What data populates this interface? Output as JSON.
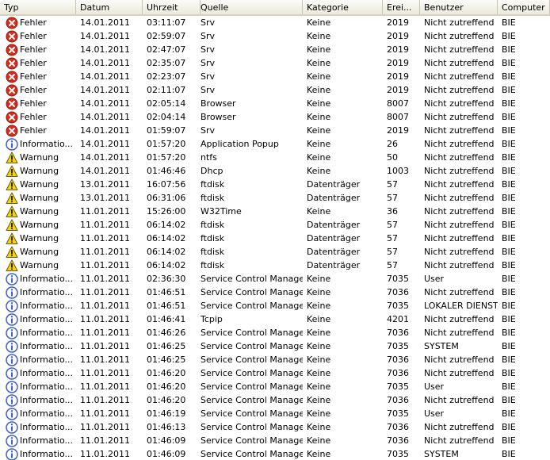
{
  "columns": [
    "Typ",
    "Datum",
    "Uhrzeit",
    "Quelle",
    "Kategorie",
    "Erei...",
    "Benutzer",
    "Computer"
  ],
  "icon_colors": {
    "error": "#d92b1c",
    "warning": "#f3d218",
    "info": "#3d5fd0"
  },
  "rows": [
    {
      "icon": "error",
      "typ": "Fehler",
      "datum": "14.01.2011",
      "zeit": "03:11:07",
      "quelle": "Srv",
      "kategorie": "Keine",
      "ereignis": "2019",
      "benutzer": "Nicht zutreffend",
      "computer": "BIE"
    },
    {
      "icon": "error",
      "typ": "Fehler",
      "datum": "14.01.2011",
      "zeit": "02:59:07",
      "quelle": "Srv",
      "kategorie": "Keine",
      "ereignis": "2019",
      "benutzer": "Nicht zutreffend",
      "computer": "BIE"
    },
    {
      "icon": "error",
      "typ": "Fehler",
      "datum": "14.01.2011",
      "zeit": "02:47:07",
      "quelle": "Srv",
      "kategorie": "Keine",
      "ereignis": "2019",
      "benutzer": "Nicht zutreffend",
      "computer": "BIE"
    },
    {
      "icon": "error",
      "typ": "Fehler",
      "datum": "14.01.2011",
      "zeit": "02:35:07",
      "quelle": "Srv",
      "kategorie": "Keine",
      "ereignis": "2019",
      "benutzer": "Nicht zutreffend",
      "computer": "BIE"
    },
    {
      "icon": "error",
      "typ": "Fehler",
      "datum": "14.01.2011",
      "zeit": "02:23:07",
      "quelle": "Srv",
      "kategorie": "Keine",
      "ereignis": "2019",
      "benutzer": "Nicht zutreffend",
      "computer": "BIE"
    },
    {
      "icon": "error",
      "typ": "Fehler",
      "datum": "14.01.2011",
      "zeit": "02:11:07",
      "quelle": "Srv",
      "kategorie": "Keine",
      "ereignis": "2019",
      "benutzer": "Nicht zutreffend",
      "computer": "BIE"
    },
    {
      "icon": "error",
      "typ": "Fehler",
      "datum": "14.01.2011",
      "zeit": "02:05:14",
      "quelle": "Browser",
      "kategorie": "Keine",
      "ereignis": "8007",
      "benutzer": "Nicht zutreffend",
      "computer": "BIE"
    },
    {
      "icon": "error",
      "typ": "Fehler",
      "datum": "14.01.2011",
      "zeit": "02:04:14",
      "quelle": "Browser",
      "kategorie": "Keine",
      "ereignis": "8007",
      "benutzer": "Nicht zutreffend",
      "computer": "BIE"
    },
    {
      "icon": "error",
      "typ": "Fehler",
      "datum": "14.01.2011",
      "zeit": "01:59:07",
      "quelle": "Srv",
      "kategorie": "Keine",
      "ereignis": "2019",
      "benutzer": "Nicht zutreffend",
      "computer": "BIE"
    },
    {
      "icon": "info",
      "typ": "Informatio...",
      "datum": "14.01.2011",
      "zeit": "01:57:20",
      "quelle": "Application Popup",
      "kategorie": "Keine",
      "ereignis": "26",
      "benutzer": "Nicht zutreffend",
      "computer": "BIE"
    },
    {
      "icon": "warning",
      "typ": "Warnung",
      "datum": "14.01.2011",
      "zeit": "01:57:20",
      "quelle": "ntfs",
      "kategorie": "Keine",
      "ereignis": "50",
      "benutzer": "Nicht zutreffend",
      "computer": "BIE"
    },
    {
      "icon": "warning",
      "typ": "Warnung",
      "datum": "14.01.2011",
      "zeit": "01:46:46",
      "quelle": "Dhcp",
      "kategorie": "Keine",
      "ereignis": "1003",
      "benutzer": "Nicht zutreffend",
      "computer": "BIE"
    },
    {
      "icon": "warning",
      "typ": "Warnung",
      "datum": "13.01.2011",
      "zeit": "16:07:56",
      "quelle": "ftdisk",
      "kategorie": "Datenträger",
      "ereignis": "57",
      "benutzer": "Nicht zutreffend",
      "computer": "BIE"
    },
    {
      "icon": "warning",
      "typ": "Warnung",
      "datum": "13.01.2011",
      "zeit": "06:31:06",
      "quelle": "ftdisk",
      "kategorie": "Datenträger",
      "ereignis": "57",
      "benutzer": "Nicht zutreffend",
      "computer": "BIE"
    },
    {
      "icon": "warning",
      "typ": "Warnung",
      "datum": "11.01.2011",
      "zeit": "15:26:00",
      "quelle": "W32Time",
      "kategorie": "Keine",
      "ereignis": "36",
      "benutzer": "Nicht zutreffend",
      "computer": "BIE"
    },
    {
      "icon": "warning",
      "typ": "Warnung",
      "datum": "11.01.2011",
      "zeit": "06:14:02",
      "quelle": "ftdisk",
      "kategorie": "Datenträger",
      "ereignis": "57",
      "benutzer": "Nicht zutreffend",
      "computer": "BIE"
    },
    {
      "icon": "warning",
      "typ": "Warnung",
      "datum": "11.01.2011",
      "zeit": "06:14:02",
      "quelle": "ftdisk",
      "kategorie": "Datenträger",
      "ereignis": "57",
      "benutzer": "Nicht zutreffend",
      "computer": "BIE"
    },
    {
      "icon": "warning",
      "typ": "Warnung",
      "datum": "11.01.2011",
      "zeit": "06:14:02",
      "quelle": "ftdisk",
      "kategorie": "Datenträger",
      "ereignis": "57",
      "benutzer": "Nicht zutreffend",
      "computer": "BIE"
    },
    {
      "icon": "warning",
      "typ": "Warnung",
      "datum": "11.01.2011",
      "zeit": "06:14:02",
      "quelle": "ftdisk",
      "kategorie": "Datenträger",
      "ereignis": "57",
      "benutzer": "Nicht zutreffend",
      "computer": "BIE"
    },
    {
      "icon": "info",
      "typ": "Informatio...",
      "datum": "11.01.2011",
      "zeit": "02:36:30",
      "quelle": "Service Control Manager",
      "kategorie": "Keine",
      "ereignis": "7035",
      "benutzer": "User",
      "computer": "BIE"
    },
    {
      "icon": "info",
      "typ": "Informatio...",
      "datum": "11.01.2011",
      "zeit": "01:46:51",
      "quelle": "Service Control Manager",
      "kategorie": "Keine",
      "ereignis": "7036",
      "benutzer": "Nicht zutreffend",
      "computer": "BIE"
    },
    {
      "icon": "info",
      "typ": "Informatio...",
      "datum": "11.01.2011",
      "zeit": "01:46:51",
      "quelle": "Service Control Manager",
      "kategorie": "Keine",
      "ereignis": "7035",
      "benutzer": "LOKALER DIENST",
      "computer": "BIE"
    },
    {
      "icon": "info",
      "typ": "Informatio...",
      "datum": "11.01.2011",
      "zeit": "01:46:41",
      "quelle": "Tcpip",
      "kategorie": "Keine",
      "ereignis": "4201",
      "benutzer": "Nicht zutreffend",
      "computer": "BIE"
    },
    {
      "icon": "info",
      "typ": "Informatio...",
      "datum": "11.01.2011",
      "zeit": "01:46:26",
      "quelle": "Service Control Manager",
      "kategorie": "Keine",
      "ereignis": "7036",
      "benutzer": "Nicht zutreffend",
      "computer": "BIE"
    },
    {
      "icon": "info",
      "typ": "Informatio...",
      "datum": "11.01.2011",
      "zeit": "01:46:25",
      "quelle": "Service Control Manager",
      "kategorie": "Keine",
      "ereignis": "7035",
      "benutzer": "SYSTEM",
      "computer": "BIE"
    },
    {
      "icon": "info",
      "typ": "Informatio...",
      "datum": "11.01.2011",
      "zeit": "01:46:25",
      "quelle": "Service Control Manager",
      "kategorie": "Keine",
      "ereignis": "7036",
      "benutzer": "Nicht zutreffend",
      "computer": "BIE"
    },
    {
      "icon": "info",
      "typ": "Informatio...",
      "datum": "11.01.2011",
      "zeit": "01:46:20",
      "quelle": "Service Control Manager",
      "kategorie": "Keine",
      "ereignis": "7036",
      "benutzer": "Nicht zutreffend",
      "computer": "BIE"
    },
    {
      "icon": "info",
      "typ": "Informatio...",
      "datum": "11.01.2011",
      "zeit": "01:46:20",
      "quelle": "Service Control Manager",
      "kategorie": "Keine",
      "ereignis": "7035",
      "benutzer": "User",
      "computer": "BIE"
    },
    {
      "icon": "info",
      "typ": "Informatio...",
      "datum": "11.01.2011",
      "zeit": "01:46:20",
      "quelle": "Service Control Manager",
      "kategorie": "Keine",
      "ereignis": "7036",
      "benutzer": "Nicht zutreffend",
      "computer": "BIE"
    },
    {
      "icon": "info",
      "typ": "Informatio...",
      "datum": "11.01.2011",
      "zeit": "01:46:19",
      "quelle": "Service Control Manager",
      "kategorie": "Keine",
      "ereignis": "7035",
      "benutzer": "User",
      "computer": "BIE"
    },
    {
      "icon": "info",
      "typ": "Informatio...",
      "datum": "11.01.2011",
      "zeit": "01:46:13",
      "quelle": "Service Control Manager",
      "kategorie": "Keine",
      "ereignis": "7036",
      "benutzer": "Nicht zutreffend",
      "computer": "BIE"
    },
    {
      "icon": "info",
      "typ": "Informatio...",
      "datum": "11.01.2011",
      "zeit": "01:46:09",
      "quelle": "Service Control Manager",
      "kategorie": "Keine",
      "ereignis": "7036",
      "benutzer": "Nicht zutreffend",
      "computer": "BIE"
    },
    {
      "icon": "info",
      "typ": "Informatio...",
      "datum": "11.01.2011",
      "zeit": "01:46:09",
      "quelle": "Service Control Manager",
      "kategorie": "Keine",
      "ereignis": "7035",
      "benutzer": "SYSTEM",
      "computer": "BIE"
    }
  ]
}
